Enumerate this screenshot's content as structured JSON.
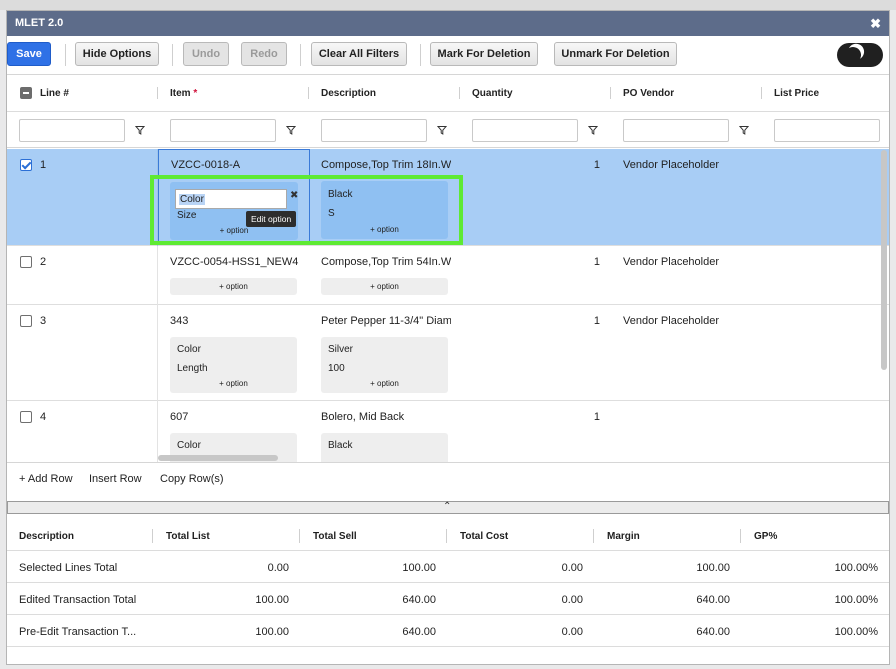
{
  "window": {
    "title": "MLET 2.0",
    "close_glyph": "✖"
  },
  "toolbar": {
    "save": "Save",
    "hide_options": "Hide Options",
    "undo": "Undo",
    "redo": "Redo",
    "clear_filters": "Clear All Filters",
    "mark_deletion": "Mark For Deletion",
    "unmark_deletion": "Unmark For Deletion",
    "theme_toggle_icon": "moon-icon"
  },
  "grid": {
    "columns": {
      "line": "Line #",
      "item": "Item",
      "item_required": "*",
      "description": "Description",
      "quantity": "Quantity",
      "po_vendor": "PO Vendor",
      "list_price": "List Price"
    },
    "add_option_label": "+ option",
    "rows": [
      {
        "line": "1",
        "selected": true,
        "item": "VZCC-0018-A",
        "description": "Compose,Top Trim 18In.W,",
        "quantity": "1",
        "vendor": "Vendor Placeholder",
        "option_names": [
          "Color",
          "Size"
        ],
        "option_values": [
          "Black",
          "S"
        ],
        "editing_value": "Color",
        "tooltip": "Edit option",
        "remove_glyph": "✖"
      },
      {
        "line": "2",
        "selected": false,
        "item": "VZCC-0054-HSS1_NEW4",
        "description": "Compose,Top Trim 54In.W",
        "quantity": "1",
        "vendor": "Vendor Placeholder"
      },
      {
        "line": "3",
        "selected": false,
        "item": "343",
        "description": "Peter Pepper 11-3/4\" Diam",
        "quantity": "1",
        "vendor": "Vendor Placeholder",
        "option_names": [
          "Color",
          "Length"
        ],
        "option_values": [
          "Silver",
          "100"
        ]
      },
      {
        "line": "4",
        "selected": false,
        "item": "607",
        "description": "Bolero, Mid Back",
        "quantity": "1",
        "vendor": "",
        "option_names": [
          "Color"
        ],
        "option_values": [
          "Black"
        ]
      }
    ],
    "footer": {
      "add_row": "+ Add Row",
      "insert_row": "Insert Row",
      "copy_rows": "Copy Row(s)"
    },
    "collapse_glyph": "⌃"
  },
  "totals": {
    "headers": [
      "Description",
      "Total List",
      "Total Sell",
      "Total Cost",
      "Margin",
      "GP%"
    ],
    "rows": [
      {
        "desc": "Selected Lines Total",
        "list": "0.00",
        "sell": "100.00",
        "cost": "0.00",
        "margin": "100.00",
        "gp": "100.00%"
      },
      {
        "desc": "Edited Transaction Total",
        "list": "100.00",
        "sell": "640.00",
        "cost": "0.00",
        "margin": "640.00",
        "gp": "100.00%"
      },
      {
        "desc": "Pre-Edit Transaction T...",
        "list": "100.00",
        "sell": "640.00",
        "cost": "0.00",
        "margin": "640.00",
        "gp": "100.00%"
      }
    ]
  },
  "colors": {
    "title_bar": "#5d6c8a",
    "primary": "#2f71e6",
    "selected_row": "#a8cdf5",
    "highlight": "#5eea33"
  }
}
